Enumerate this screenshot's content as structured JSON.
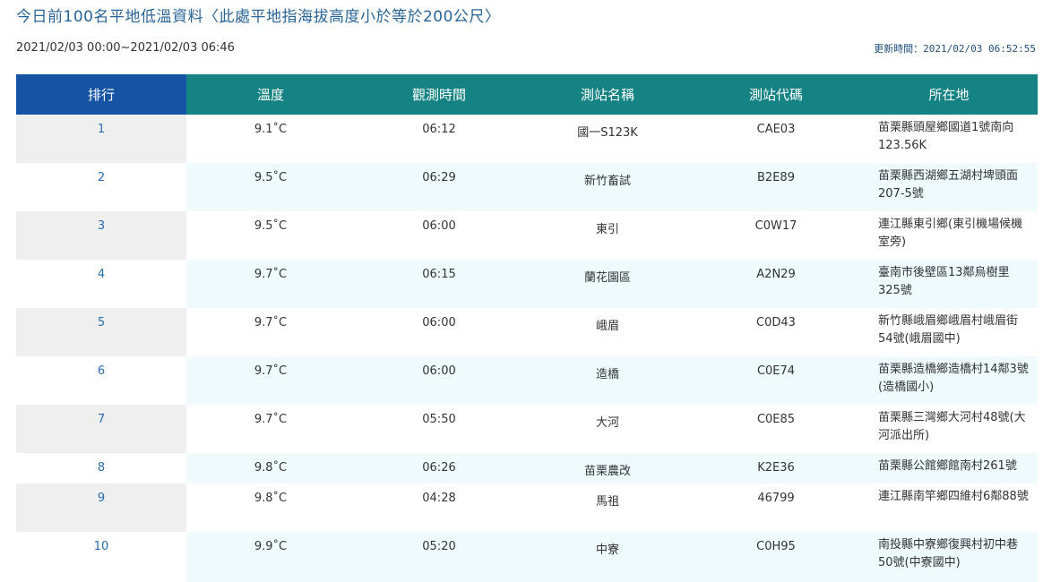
{
  "header": {
    "title": "今日前100名平地低溫資料〈此處平地指海拔高度小於等於200公尺〉",
    "range": "2021/02/03 00:00~2021/02/03 06:46",
    "updated": "更新時間：2021/02/03 06:52:55"
  },
  "table": {
    "columns": [
      "排行",
      "溫度",
      "觀測時間",
      "測站名稱",
      "測站代碼",
      "所在地"
    ],
    "rows": [
      {
        "rank": "1",
        "temp": "9.1˚C",
        "time": "06:12",
        "station": "國一S123K",
        "code": "CAE03",
        "location": "苗栗縣頭屋鄉國道1號南向123.56K"
      },
      {
        "rank": "2",
        "temp": "9.5˚C",
        "time": "06:29",
        "station": "新竹畜試",
        "code": "B2E89",
        "location": "苗栗縣西湖鄉五湖村埤頭面207-5號"
      },
      {
        "rank": "3",
        "temp": "9.5˚C",
        "time": "06:00",
        "station": "東引",
        "code": "C0W17",
        "location": "連江縣東引鄉(東引機場候機室旁)"
      },
      {
        "rank": "4",
        "temp": "9.7˚C",
        "time": "06:15",
        "station": "蘭花園區",
        "code": "A2N29",
        "location": "臺南市後壁區13鄰烏樹里325號"
      },
      {
        "rank": "5",
        "temp": "9.7˚C",
        "time": "06:00",
        "station": "峨眉",
        "code": "C0D43",
        "location": "新竹縣峨眉鄉峨眉村峨眉街54號(峨眉國中)"
      },
      {
        "rank": "6",
        "temp": "9.7˚C",
        "time": "06:00",
        "station": "造橋",
        "code": "C0E74",
        "location": "苗栗縣造橋鄉造橋村14鄰3號(造橋國小)"
      },
      {
        "rank": "7",
        "temp": "9.7˚C",
        "time": "05:50",
        "station": "大河",
        "code": "C0E85",
        "location": "苗栗縣三灣鄉大河村48號(大河派出所)"
      },
      {
        "rank": "8",
        "temp": "9.8˚C",
        "time": "06:26",
        "station": "苗栗農改",
        "code": "K2E36",
        "location": "苗栗縣公館鄉館南村261號"
      },
      {
        "rank": "9",
        "temp": "9.8˚C",
        "time": "04:28",
        "station": "馬祖",
        "code": "46799",
        "location": "連江縣南竿鄉四維村6鄰88號"
      },
      {
        "rank": "10",
        "temp": "9.9˚C",
        "time": "05:20",
        "station": "中寮",
        "code": "C0H95",
        "location": "南投縣中寮鄉復興村初中巷50號(中寮國中)"
      }
    ]
  }
}
